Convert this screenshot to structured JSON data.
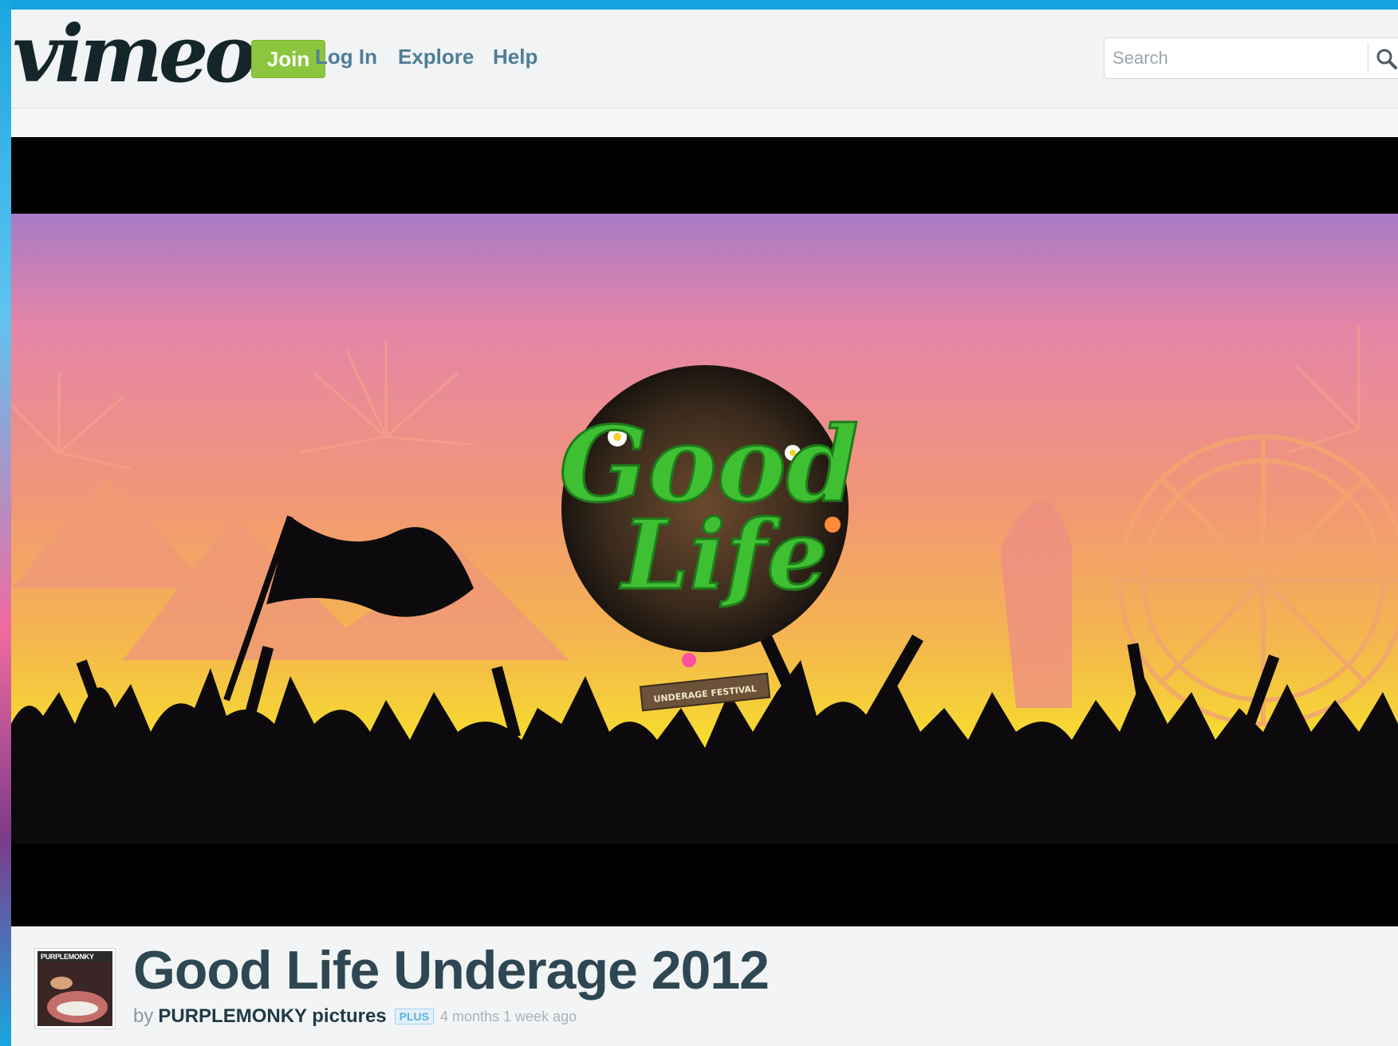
{
  "header": {
    "logo": "vimeo",
    "join_label": "Join",
    "nav": [
      {
        "label": "Log In"
      },
      {
        "label": "Explore"
      },
      {
        "label": "Help"
      }
    ],
    "search": {
      "placeholder": "Search",
      "value": ""
    }
  },
  "video": {
    "artwork_text_1": "Good",
    "artwork_text_2": "Life",
    "artwork_banner": "UNDERAGE FESTIVAL"
  },
  "details": {
    "avatar_text": "PURPLEMONKY",
    "title": "Good Life Underage 2012",
    "by": "by",
    "owner": "PURPLEMONKY pictures",
    "badge": "PLUS",
    "time": "4 months 1 week ago"
  },
  "colors": {
    "accent_green": "#8cc63f",
    "nav_blue": "#4d7f96",
    "title_dark": "#2f4753",
    "frame_blue": "#14a3df"
  }
}
